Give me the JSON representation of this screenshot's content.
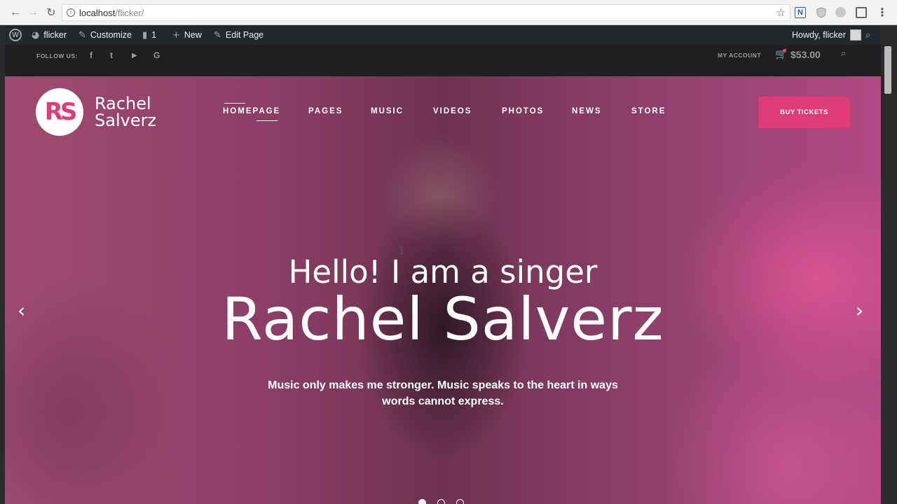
{
  "browser": {
    "url_host": "localhost",
    "url_path": "/flicker/",
    "extension_n": "N"
  },
  "wp_admin_bar": {
    "site_name": "flicker",
    "customize": "Customize",
    "comments_count": "1",
    "new": "New",
    "edit_page": "Edit Page",
    "howdy": "Howdy, flicker"
  },
  "topbar": {
    "follow_us": "FOLLOW US:",
    "social_icons": [
      "facebook-icon",
      "twitter-icon",
      "youtube-icon",
      "google-icon"
    ],
    "social_glyphs": [
      "f",
      "t",
      "▶",
      "G"
    ],
    "my_account": "MY ACCOUNT",
    "cart_total": "$53.00"
  },
  "header": {
    "logo_monogram": "RS",
    "logo_line1": "Rachel",
    "logo_line2": "Salverz",
    "nav": [
      "HOMEPAGE",
      "PAGES",
      "MUSIC",
      "VIDEOS",
      "PHOTOS",
      "NEWS",
      "STORE"
    ],
    "active_nav": "HOMEPAGE",
    "buy_tickets": "BUY TICKETS"
  },
  "hero": {
    "greeting": "Hello! I am a singer",
    "name": "Rachel Salverz",
    "tagline_line1": "Music only makes me stronger. Music speaks to the heart in ways",
    "tagline_line2": "words cannot express.",
    "slides": 3,
    "active_slide": 1
  },
  "colors": {
    "accent": "#e03c78",
    "admin_bar": "#23282d",
    "topbar": "#1f1f21"
  }
}
